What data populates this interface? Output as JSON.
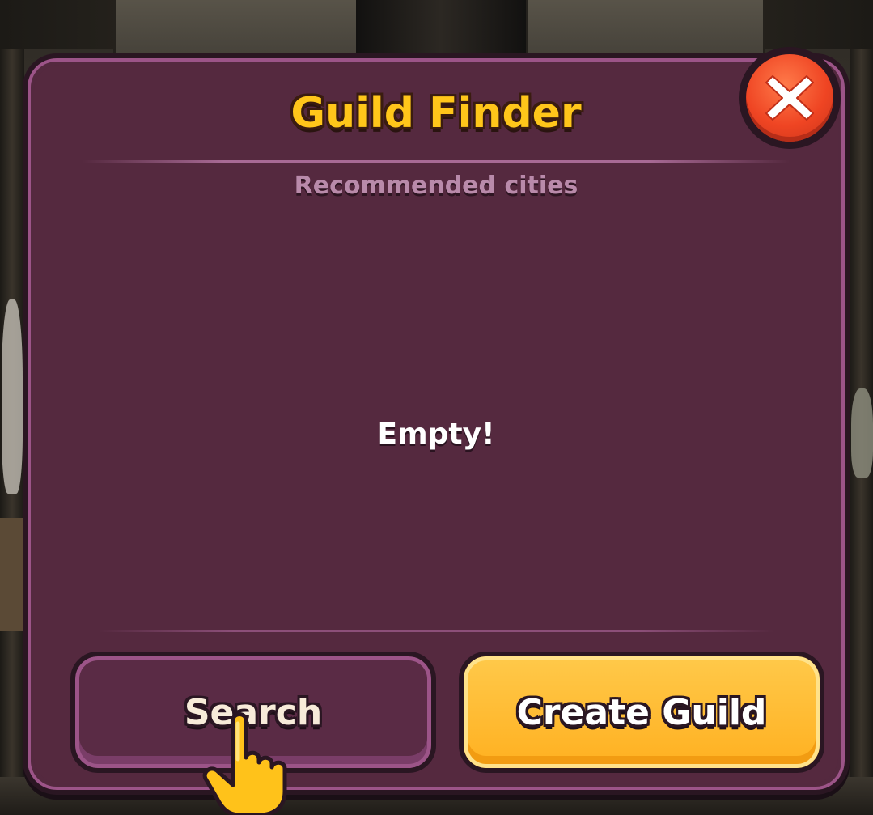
{
  "dialog": {
    "title": "Guild Finder",
    "subtitle": "Recommended cities",
    "empty_message": "Empty!"
  },
  "buttons": {
    "search_label": "Search",
    "create_label": "Create Guild"
  },
  "icons": {
    "close": "close-icon",
    "hand": "pointing-hand-icon"
  },
  "colors": {
    "title": "#ffc61a",
    "panel": "#54293f",
    "panel_border": "#9c5488",
    "create_button": "#ffb020",
    "close_button": "#ef4523"
  }
}
